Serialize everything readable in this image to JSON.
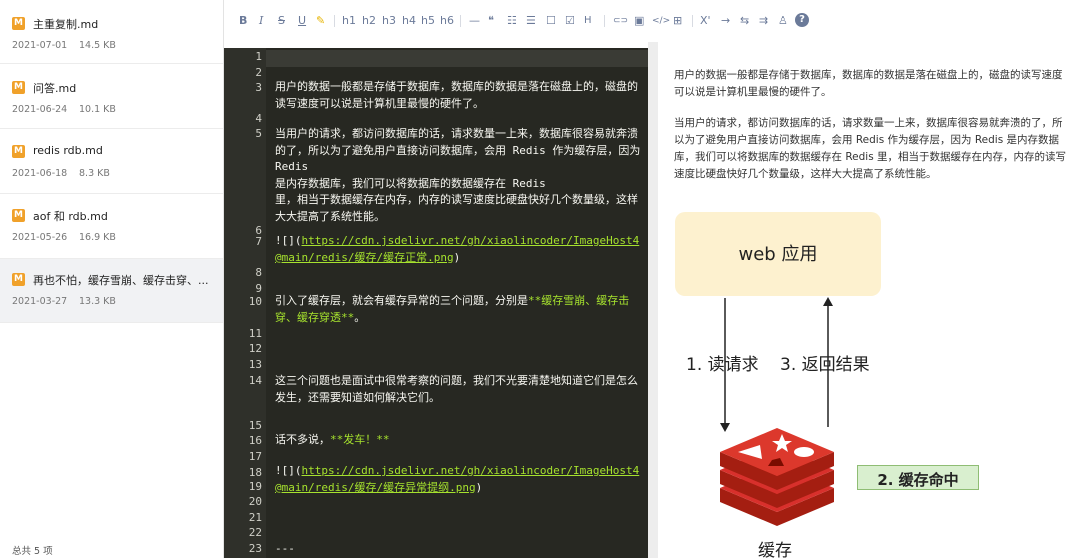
{
  "sidebar": {
    "files": [
      {
        "name": "主重复制.md",
        "date": "2021-07-01",
        "size": "14.5 KB"
      },
      {
        "name": "问答.md",
        "date": "2021-06-24",
        "size": "10.1 KB"
      },
      {
        "name": "redis rdb.md",
        "date": "2021-06-18",
        "size": "8.3 KB"
      },
      {
        "name": "aof 和 rdb.md",
        "date": "2021-05-26",
        "size": "16.9 KB"
      },
      {
        "name": "再也不怕，缓存雪崩、缓存击穿、...",
        "date": "2021-03-27",
        "size": "13.3 KB"
      }
    ],
    "badge": "M",
    "total": "总共 5 项"
  },
  "toolbar": {
    "bold": "B",
    "italic": "I",
    "strike": "S",
    "underline": "U",
    "highlight": "✎",
    "h1": "h1",
    "h2": "h2",
    "h3": "h3",
    "h4": "h4",
    "h5": "h5",
    "h6": "h6",
    "hr": "—",
    "quote": "❝",
    "ul": "☷",
    "ol": "☰",
    "checkbox": "☐",
    "checked": "☑",
    "sub": "H",
    "link": "⊂⊃",
    "image": "▣",
    "code": "</>",
    "table": "⊞",
    "sup": "X'",
    "arrow_right": "→",
    "arrow_swap": "⇆",
    "indent": "⇉",
    "shirt": "♙",
    "help": "?"
  },
  "editor": {
    "line_numbers": [
      "1",
      "2",
      "3",
      "4",
      "5",
      "6",
      "7",
      "8",
      "9",
      "10",
      "11",
      "12",
      "13",
      "14",
      "15",
      "16",
      "17",
      "18",
      "19",
      "20",
      "21",
      "22",
      "23"
    ],
    "lines": {
      "l3": "用户的数据一般都是存储于数据库，数据库的数据是落在磁盘上的，磁盘的读写速度可以说是计算机里最慢的硬件了。",
      "l5": "当用户的请求，都访问数据库的话，请求数量一上来，数据库很容易就奔溃的了，所以为了避免用户直接访问数据库，会用 Redis 作为缓存层，因为 Redis\n是内存数据库，我们可以将数据库的数据缓存在 Redis\n里，相当于数据缓存在内存，内存的读写速度比硬盘快好几个数量级，这样大大提高了系统性能。",
      "l7_prefix": "![](",
      "l7_link": "https://cdn.jsdelivr.net/gh/xiaolincoder/ImageHost4@main/redis/缓存/缓存正常.png",
      "l7_suffix": ")",
      "l10_text": "引入了缓存层，就会有缓存异常的三个问题，分别是",
      "l10_strong": "**缓存雪崩、缓存击穿、缓存穿透**",
      "l10_end": "。",
      "l14": "这三个问题也是面试中很常考察的问题，我们不光要清楚地知道它们是怎么发生，还需要知道如何解决它们。",
      "l17_text": "话不多说，",
      "l17_strong": "**发车！**",
      "l19_prefix": "![](",
      "l19_link": "https://cdn.jsdelivr.net/gh/xiaolincoder/ImageHost4@main/redis/缓存/缓存异常提纲.png",
      "l19_suffix": ")",
      "l23": "---"
    }
  },
  "preview": {
    "p1": "用户的数据一般都是存储于数据库，数据库的数据是落在磁盘上的，磁盘的读写速度可以说是计算机里最慢的硬件了。",
    "p2": "当用户的请求，都访问数据库的话，请求数量一上来，数据库很容易就奔溃的了，所以为了避免用户直接访问数据库，会用 Redis 作为缓存层，因为 Redis 是内存数据库，我们可以将数据库的数据缓存在 Redis 里，相当于数据缓存在内存，内存的读写速度比硬盘快好几个数量级，这样大大提高了系统性能。",
    "diagram": {
      "web": "web 应用",
      "read": "1. 读请求",
      "ret": "3. 返回结果",
      "hit": "2. 缓存命中",
      "cache": "缓存"
    }
  },
  "colors": {
    "badge": "#f0a12a",
    "editor_bg": "#272822",
    "link": "#a6e22e",
    "redis": "#d8302c"
  }
}
